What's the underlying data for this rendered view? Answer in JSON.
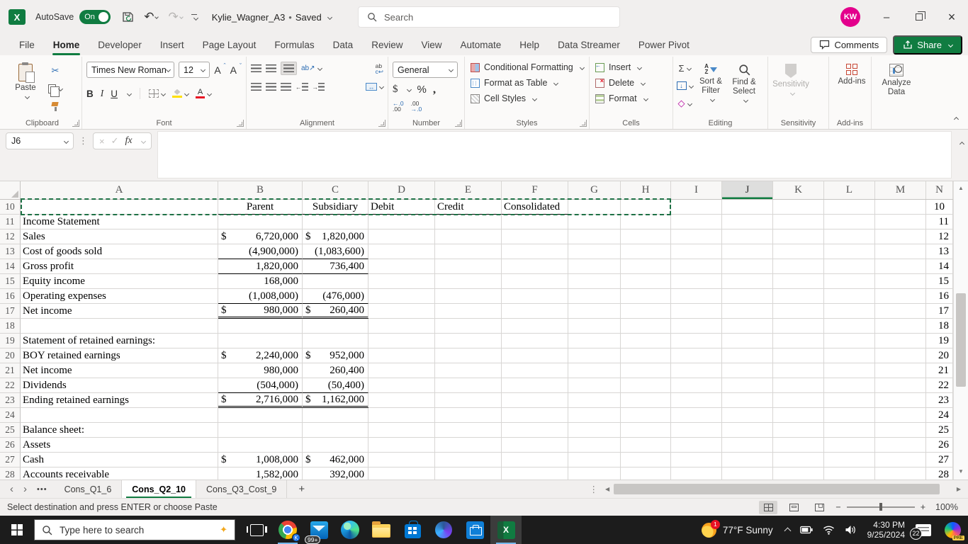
{
  "titlebar": {
    "autosave_label": "AutoSave",
    "autosave_state": "On",
    "doc_name": "Kylie_Wagner_A3",
    "doc_sep": "•",
    "doc_status": "Saved",
    "search_placeholder": "Search",
    "avatar_initials": "KW"
  },
  "ribbon": {
    "tabs": [
      "File",
      "Home",
      "Developer",
      "Insert",
      "Page Layout",
      "Formulas",
      "Data",
      "Review",
      "View",
      "Automate",
      "Help",
      "Data Streamer",
      "Power Pivot"
    ],
    "active_tab": "Home",
    "comments_label": "Comments",
    "share_label": "Share",
    "clipboard": {
      "label": "Clipboard",
      "paste": "Paste"
    },
    "font": {
      "label": "Font",
      "font_name": "Times New Roman",
      "font_size": "12"
    },
    "alignment": {
      "label": "Alignment"
    },
    "number": {
      "label": "Number",
      "format": "General"
    },
    "styles": {
      "label": "Styles",
      "conditional_formatting": "Conditional Formatting",
      "format_as_table": "Format as Table",
      "cell_styles": "Cell Styles"
    },
    "cells": {
      "label": "Cells",
      "insert": "Insert",
      "delete": "Delete",
      "format": "Format"
    },
    "editing": {
      "label": "Editing",
      "sort_filter": "Sort & Filter",
      "find_select": "Find & Select"
    },
    "sensitivity": {
      "label": "Sensitivity",
      "button": "Sensitivity"
    },
    "addins": {
      "label": "Add-ins",
      "button": "Add-ins"
    },
    "analyze": {
      "button": "Analyze Data"
    }
  },
  "icons": {
    "scissors": "✂",
    "undo": "↶",
    "redo": "↷",
    "sigma": "Σ",
    "dollar": "$",
    "percent": "%",
    "comma": ",",
    "bold": "B",
    "italic": "I",
    "underline": "U",
    "eraser": "◇",
    "fx": "fx",
    "vdots": "⋮",
    "check": "✓",
    "close_x": "×",
    "cancel_x": "×",
    "minimize": "–",
    "prev": "‹",
    "next": "›",
    "dots": "•••",
    "plus": "+",
    "up_arrow": "▲",
    "down_arrow": "▼",
    "left_arrow": "◀",
    "right_arrow": "▶",
    "grow_a": "A",
    "caret_up": "ˆ",
    "caret_dn": "ˇ",
    "fill_arrow": "↓",
    "orientation": "ab↗",
    "wrap_top": "ab",
    "wrap_bot": "c↩",
    "merge": "↔",
    "inc_dec_top": "←.0",
    "inc_dec_bot": ".00",
    "dec_dec_top": ".00",
    "dec_dec_bot": "→.0",
    "sort_a": "A",
    "sort_z": "Z",
    "spark": "✦",
    "minus": "−",
    "zoom_out": "—",
    "zoom_in": "+"
  },
  "formula_bar": {
    "name_box": "J6",
    "fx": "fx"
  },
  "grid": {
    "columns": [
      "A",
      "B",
      "C",
      "D",
      "E",
      "F",
      "G",
      "H",
      "I",
      "J",
      "K",
      "L",
      "M",
      "N"
    ],
    "selected_column": "J",
    "rows": [
      {
        "n": "10",
        "b": "Parent",
        "c": "Subsidiary",
        "d": "Debit",
        "e": "Credit",
        "f": "Consolidated",
        "hdr": true,
        "ants": true
      },
      {
        "n": "11",
        "a": "Income Statement"
      },
      {
        "n": "12",
        "a": "Sales",
        "bd": "$",
        "b": "6,720,000",
        "cd": "$",
        "c": "1,820,000"
      },
      {
        "n": "13",
        "a": "Cost of goods sold",
        "b": "(4,900,000)",
        "c": "(1,083,600)",
        "line": "single"
      },
      {
        "n": "14",
        "a": "Gross profit",
        "b": "1,820,000",
        "c": "736,400",
        "line": "single"
      },
      {
        "n": "15",
        "a": "Equity income",
        "b": "168,000"
      },
      {
        "n": "16",
        "a": "Operating expenses",
        "b": "(1,008,000)",
        "c": "(476,000)",
        "line": "single"
      },
      {
        "n": "17",
        "a": "Net income",
        "bd": "$",
        "b": "980,000",
        "cd": "$",
        "c": "260,400",
        "line": "double"
      },
      {
        "n": "18"
      },
      {
        "n": "19",
        "a": "Statement of retained earnings:"
      },
      {
        "n": "20",
        "a": "BOY retained earnings",
        "bd": "$",
        "b": "2,240,000",
        "cd": "$",
        "c": "952,000"
      },
      {
        "n": "21",
        "a": "Net income",
        "b": "980,000",
        "c": "260,400"
      },
      {
        "n": "22",
        "a": "Dividends",
        "b": "(504,000)",
        "c": "(50,400)",
        "line": "single"
      },
      {
        "n": "23",
        "a": "Ending retained earnings",
        "bd": "$",
        "b": "2,716,000",
        "cd": "$",
        "c": "1,162,000",
        "line": "double"
      },
      {
        "n": "24"
      },
      {
        "n": "25",
        "a": "Balance sheet:"
      },
      {
        "n": "26",
        "a": "Assets"
      },
      {
        "n": "27",
        "a": "Cash",
        "bd": "$",
        "b": "1,008,000",
        "cd": "$",
        "c": "462,000"
      },
      {
        "n": "28",
        "a": "Accounts receivable",
        "b": "1,582,000",
        "c": "392,000"
      }
    ]
  },
  "sheet_tabs": {
    "tabs": [
      "Cons_Q1_6",
      "Cons_Q2_10",
      "Cons_Q3_Cost_9"
    ],
    "active": "Cons_Q2_10"
  },
  "status_bar": {
    "message": "Select destination and press ENTER or choose Paste",
    "zoom": "100%"
  },
  "taskbar": {
    "search_placeholder": "Type here to search",
    "weather": "77°F Sunny",
    "time": "4:30 PM",
    "date": "9/25/2024",
    "mail_badge": "99+",
    "notif_badge": "22",
    "weather_badge": "1",
    "chrome_badge": "K",
    "copilot_badge": "PRE"
  },
  "colors": {
    "excel_green": "#107C41",
    "avatar_pink": "#E3008C",
    "ants_green": "#1E7145"
  }
}
